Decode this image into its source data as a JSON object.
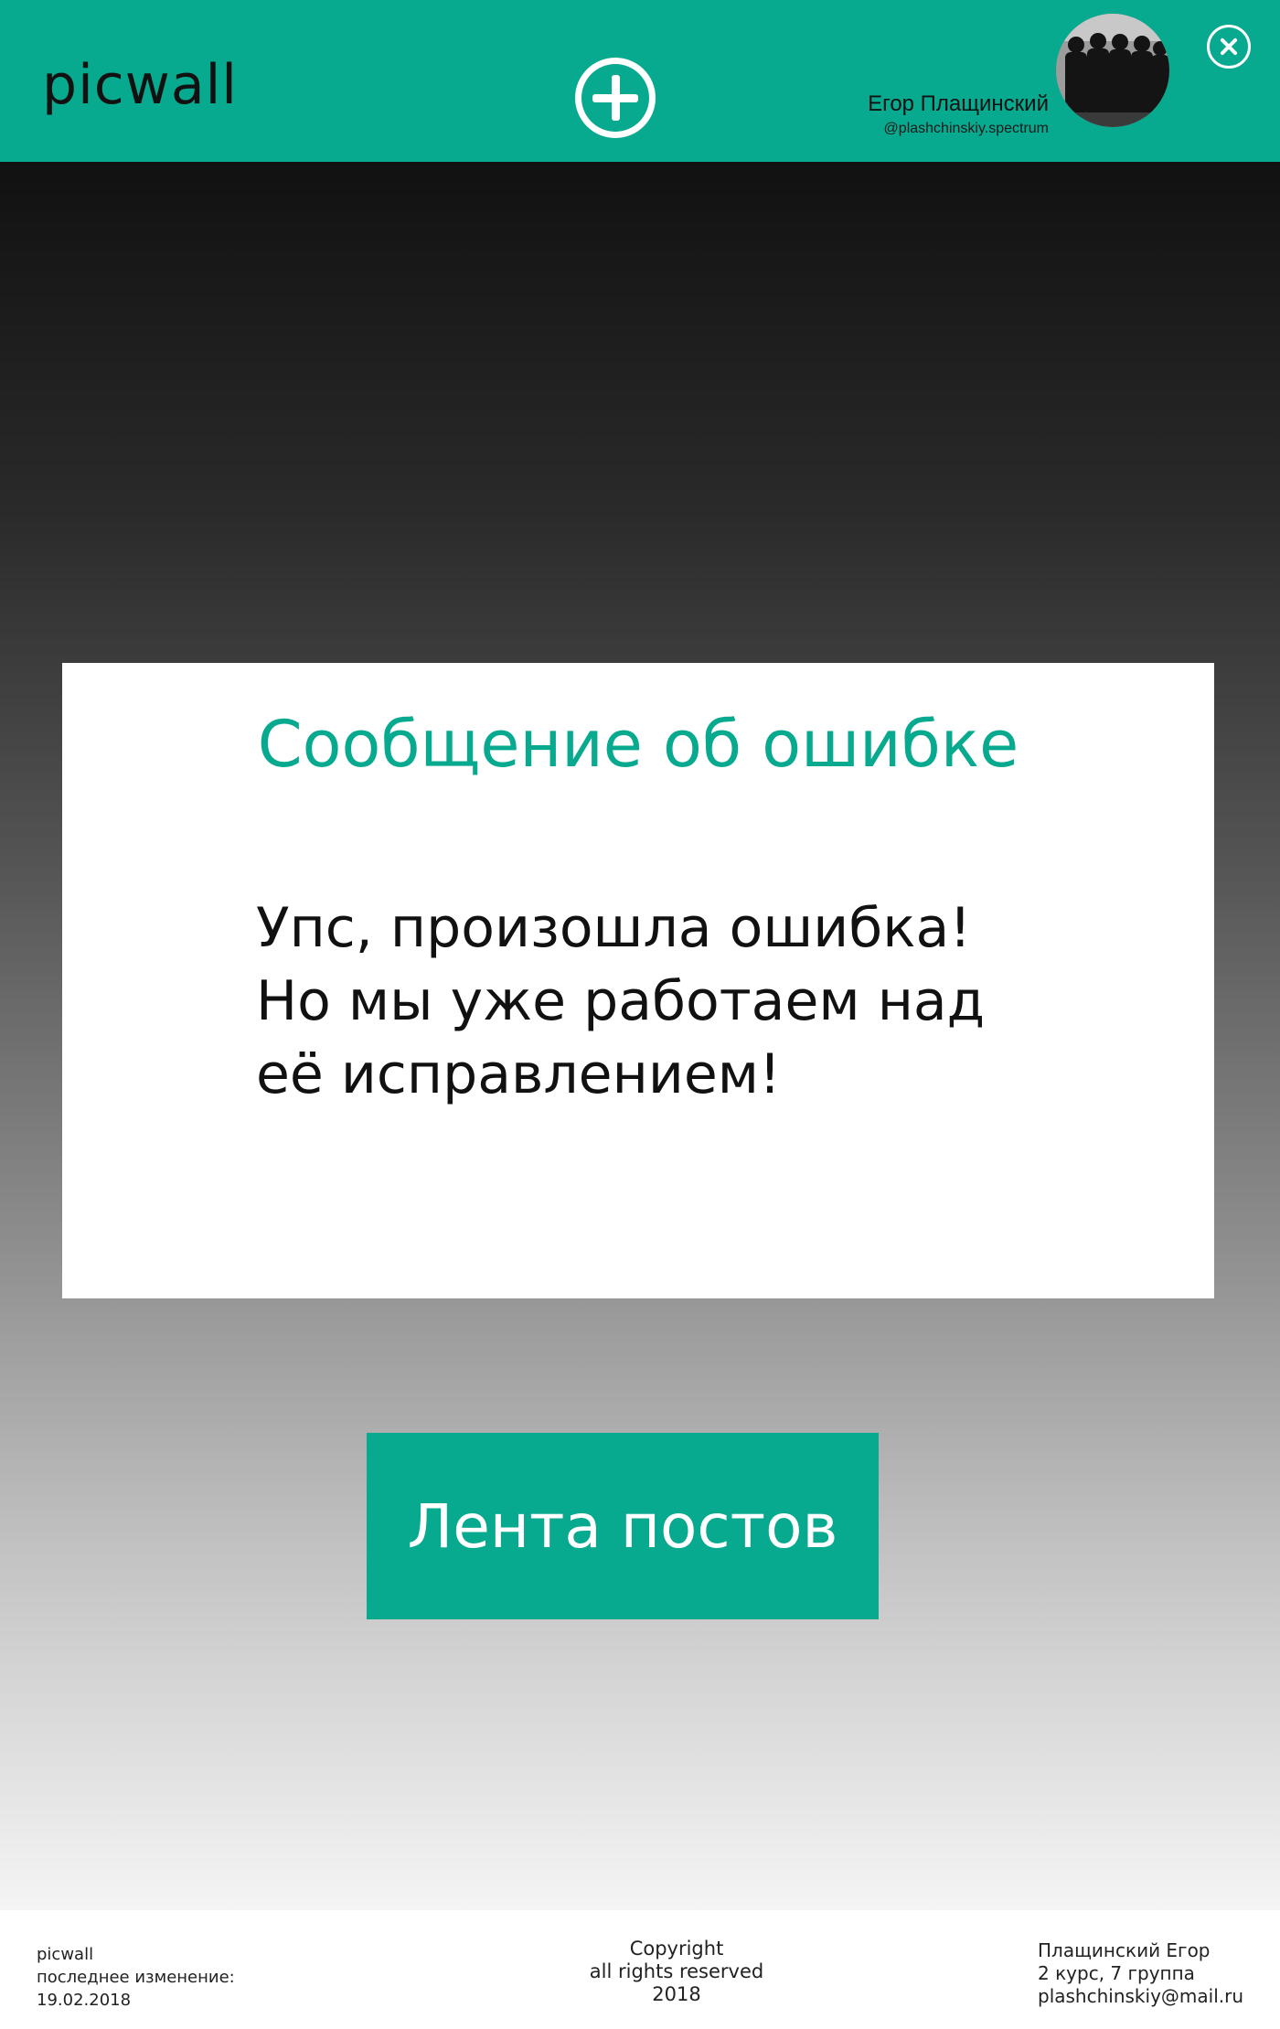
{
  "header": {
    "logo": "picwall",
    "user_name": "Егор Плащинский",
    "user_handle": "@plashchinskiy.spectrum",
    "add_icon": "plus-circle-icon",
    "close_icon": "close-circle-icon"
  },
  "error": {
    "title": "Сообщение об ошибке",
    "lines": [
      "Упс, произошла ошибка!",
      "Но мы уже работаем над",
      "её исправлением!"
    ]
  },
  "feed_button": "Лента постов",
  "footer": {
    "left": [
      "picwall",
      "последнее изменение:",
      "19.02.2018"
    ],
    "center": [
      "Copyright",
      "all rights reserved",
      "2018"
    ],
    "right": [
      "Плащинский Егор",
      "2 курс, 7 группа",
      "plashchinskiy@mail.ru"
    ]
  },
  "colors": {
    "accent": "#07a98f",
    "error_title": "#07a98f"
  }
}
